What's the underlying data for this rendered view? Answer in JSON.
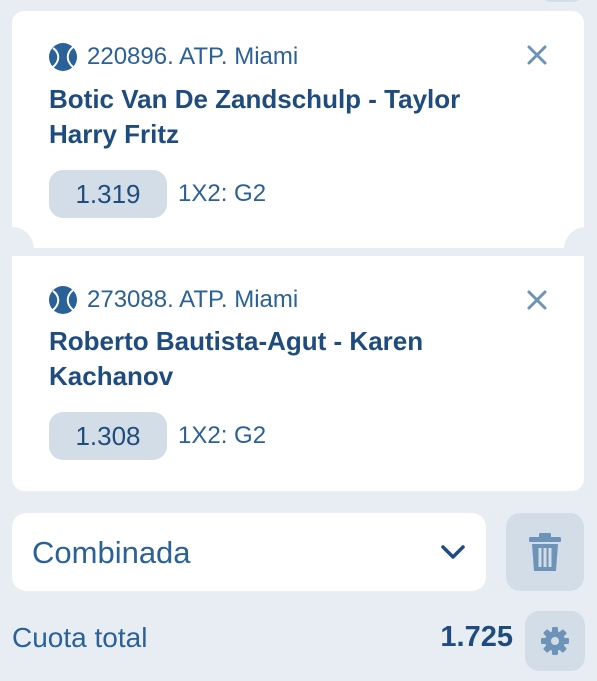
{
  "bets": [
    {
      "event": "220896. ATP. Miami",
      "match": "Botic Van De Zandschulp - Taylor Harry Fritz",
      "odds": "1.319",
      "market": "1X2: G2",
      "sport_icon": "tennis-ball-icon"
    },
    {
      "event": "273088. ATP. Miami",
      "match": "Roberto Bautista-Agut - Karen Kachanov",
      "odds": "1.308",
      "market": "1X2: G2",
      "sport_icon": "tennis-ball-icon"
    }
  ],
  "bet_type": {
    "selected": "Combinada"
  },
  "total": {
    "label": "Cuota total",
    "value": "1.725"
  },
  "colors": {
    "background": "#e8edf3",
    "card": "#ffffff",
    "primary_text": "#1f4c7e",
    "secondary_text": "#2a6199",
    "pill": "#d3dde8",
    "icon": "#6e93b8"
  }
}
